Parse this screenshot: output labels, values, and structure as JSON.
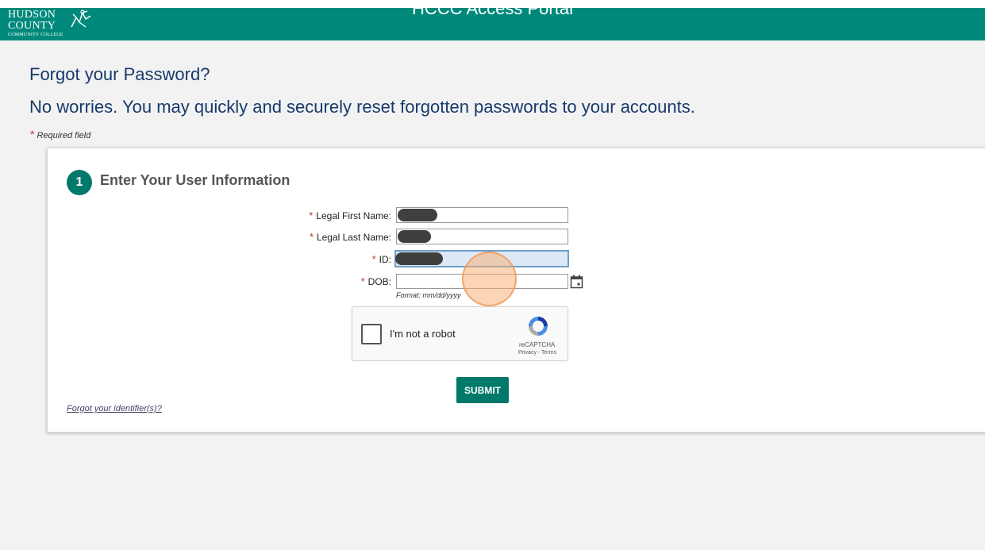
{
  "header": {
    "logo_line1": "HUDSON",
    "logo_line2": "COUNTY",
    "logo_line3": "COMMUNITY COLLEGE",
    "title": "HCCC Access Portal",
    "bg_color": "#00897b"
  },
  "page": {
    "title": "Forgot your Password?",
    "subtitle": "No worries. You may quickly and securely reset forgotten passwords to your accounts.",
    "required_marker": "*",
    "required_note": "Required field"
  },
  "form": {
    "step_number": "1",
    "step_title": "Enter Your User Information",
    "fields": {
      "first_name": {
        "label": "Legal First Name:",
        "value": ""
      },
      "last_name": {
        "label": "Legal Last Name:",
        "value": ""
      },
      "id": {
        "label": "ID:",
        "value": ""
      },
      "dob": {
        "label": "DOB:",
        "value": "",
        "format_hint": "Format: mm/dd/yyyy"
      }
    },
    "captcha": {
      "label": "I'm not a robot",
      "brand": "reCAPTCHA",
      "links": "Privacy - Terms"
    },
    "submit_label": "SUBMIT",
    "forgot_identifier_link": "Forgot your identifier(s)?",
    "accent_color": "#00796b",
    "required_color": "#c0392b"
  }
}
